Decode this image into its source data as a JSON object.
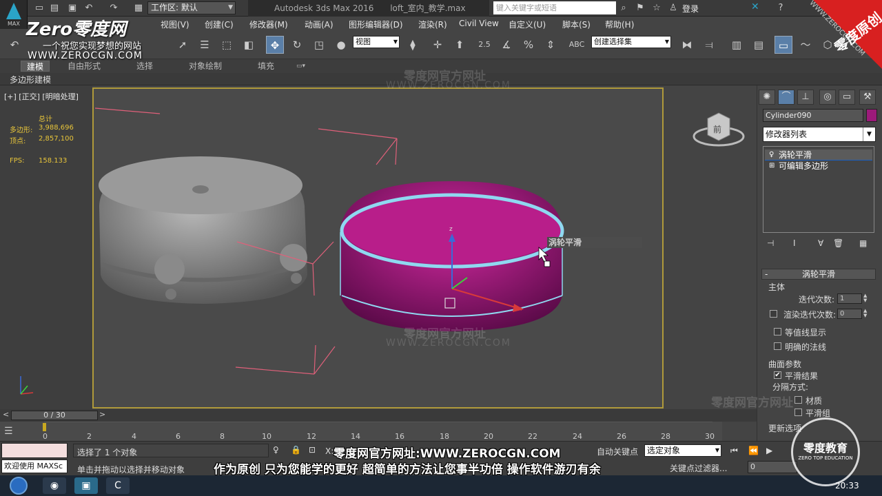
{
  "app": {
    "logo_label": "MAX",
    "title": "Autodesk 3ds Max 2016",
    "file": "loft_室内_教学.max",
    "workspace_label": "工作区: 默认",
    "search_placeholder": "键入关键字或短语",
    "login_label": "登录"
  },
  "menu": [
    "视图(V)",
    "创建(C)",
    "修改器(M)",
    "动画(A)",
    "图形编辑器(D)",
    "渲染(R)",
    "Civil View",
    "自定义(U)",
    "脚本(S)",
    "帮助(H)"
  ],
  "toolbar": {
    "view_select": "视图",
    "snap_angle": "2.5",
    "selection_set": "创建选择集"
  },
  "ribbon": {
    "tabs": [
      "建模",
      "自由形式",
      "选择",
      "对象绘制",
      "填充"
    ],
    "active_tab": "建模",
    "sub_label": "多边形建模"
  },
  "viewport": {
    "label": "[+] [正交] [明暗处理]",
    "stats": {
      "total_label": "总计",
      "poly_label": "多边形:",
      "poly_value": "3,988,696",
      "vert_label": "顶点:",
      "vert_value": "2,857,100",
      "fps_label": "FPS:",
      "fps_value": "158.133"
    },
    "tooltip": "涡轮平滑",
    "viewcube_label": "前",
    "axis_z": "z",
    "axis_y": "y",
    "axis_x": "x"
  },
  "command_panel": {
    "object_name": "Cylinder090",
    "object_color": "#9c1a7a",
    "modifier_list_label": "修改器列表",
    "stack": [
      {
        "label": "涡轮平滑",
        "selected": true
      },
      {
        "label": "可编辑多边形",
        "selected": false
      }
    ],
    "rollout_title": "涡轮平滑",
    "main_group": "主体",
    "iterations_label": "迭代次数:",
    "iterations_value": "1",
    "render_iters_label": "渲染迭代次数:",
    "render_iters_value": "0",
    "isoline_label": "等值线显示",
    "explicit_normals_label": "明确的法线",
    "surface_group": "曲面参数",
    "smooth_result_label": "平滑结果",
    "separate_label": "分隔方式:",
    "materials_label": "材质",
    "smoothing_groups_label": "平滑组",
    "update_label": "更新选项"
  },
  "timeline": {
    "frame_display": "0 / 30",
    "ticks": [
      "0",
      "2",
      "4",
      "6",
      "8",
      "10",
      "12",
      "14",
      "16",
      "18",
      "20",
      "22",
      "24",
      "26",
      "28",
      "30"
    ]
  },
  "status": {
    "welcome": "欢迎使用 MAXSc",
    "selected": "选择了 1 个对象",
    "prompt": "单击并拖动以选择并移动对象",
    "autokey_label": "自动关键点",
    "set_key_filter": "选定对象",
    "key_filter_label": "关键点过滤器...",
    "frame_value": "0",
    "x_label": "X:"
  },
  "taskbar": {
    "clock": "20:33"
  },
  "watermark": {
    "logo": "Zero零度网",
    "slogan": "一个祝您实现梦想的网站",
    "url": "WWW.ZEROCGN.COM",
    "mid_cn": "零度网官方网址",
    "mid_en": "WWW.ZEROCGN.COM",
    "corner_cn": "零度原创",
    "corner_url": "WWW.ZEROCGN.COM",
    "subtitle1": "零度网官方网址:WWW.ZEROCGN.COM",
    "subtitle2": "作为原创 只为您能学的更好 超简单的方法让您事半功倍 操作软件游刃有余",
    "edu_cn": "零度教育",
    "edu_en": "ZERO TOP EDUCATION"
  }
}
